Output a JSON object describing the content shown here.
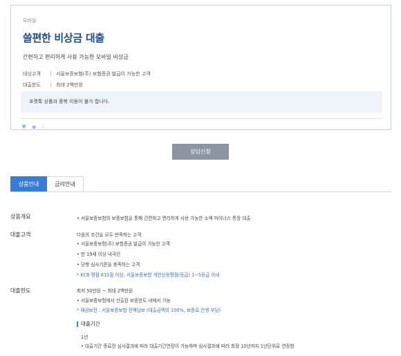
{
  "card": {
    "tag": "모바일",
    "title": "쓸편한 비상금 대출",
    "subtitle": "간편하고 편리하게 사용 가능한 모바일 비상금",
    "target_label": "대상고객",
    "target_value": "서울보증보험(주) 보험증권 발급이 가능한 고객",
    "limit_label": "대출한도",
    "limit_value": "최대 2백만원",
    "notice": "포켓톡 상품과 중복 이용이 불가 합니다."
  },
  "icons": [
    "heart-icon",
    "tag-icon",
    "share-icon"
  ],
  "consult_button": "상담신청",
  "tabs": [
    {
      "label": "상품안내",
      "active": true
    },
    {
      "label": "금리안내",
      "active": false
    }
  ],
  "sections": {
    "overview": {
      "label": "상품개요",
      "lines": [
        "• 서울보증보험의 보증보험을 통해 간편하고 편리하게 사용 가능한 소액 마이너스 통장 대출"
      ]
    },
    "target": {
      "label": "대출고객",
      "lines": [
        "다음의 조건을 모두 만족하는 고객",
        "• 서울보증보험(주) 보험증권 발급이 가능한 고객",
        "• 만 19세 이상 내국인",
        "• 당행 심사기준을 충족하는 고객",
        "* KCB 평점 631점 이상, 서울보증보험 개인신용평점(등급) 1~5등급 이내"
      ]
    },
    "limit": {
      "label": "대출한도",
      "lines": [
        "최저 50만원 ~ 최대 2백만원",
        "• 서울보증보험에서 산출된 보증한도 내에서 가능",
        "* 채권보전 : 서울보증보험 전액담보 (대출금액의 100%, 보증료 은행 부담)"
      ],
      "subhead": "대출기간",
      "sub_lines": [
        "1년",
        "• 대출기간 종료전 심사결과에 따라 대출기간연장이 가능하며 심사결과에 따라 최장 10년까지 1년단위로 연장함"
      ]
    }
  }
}
